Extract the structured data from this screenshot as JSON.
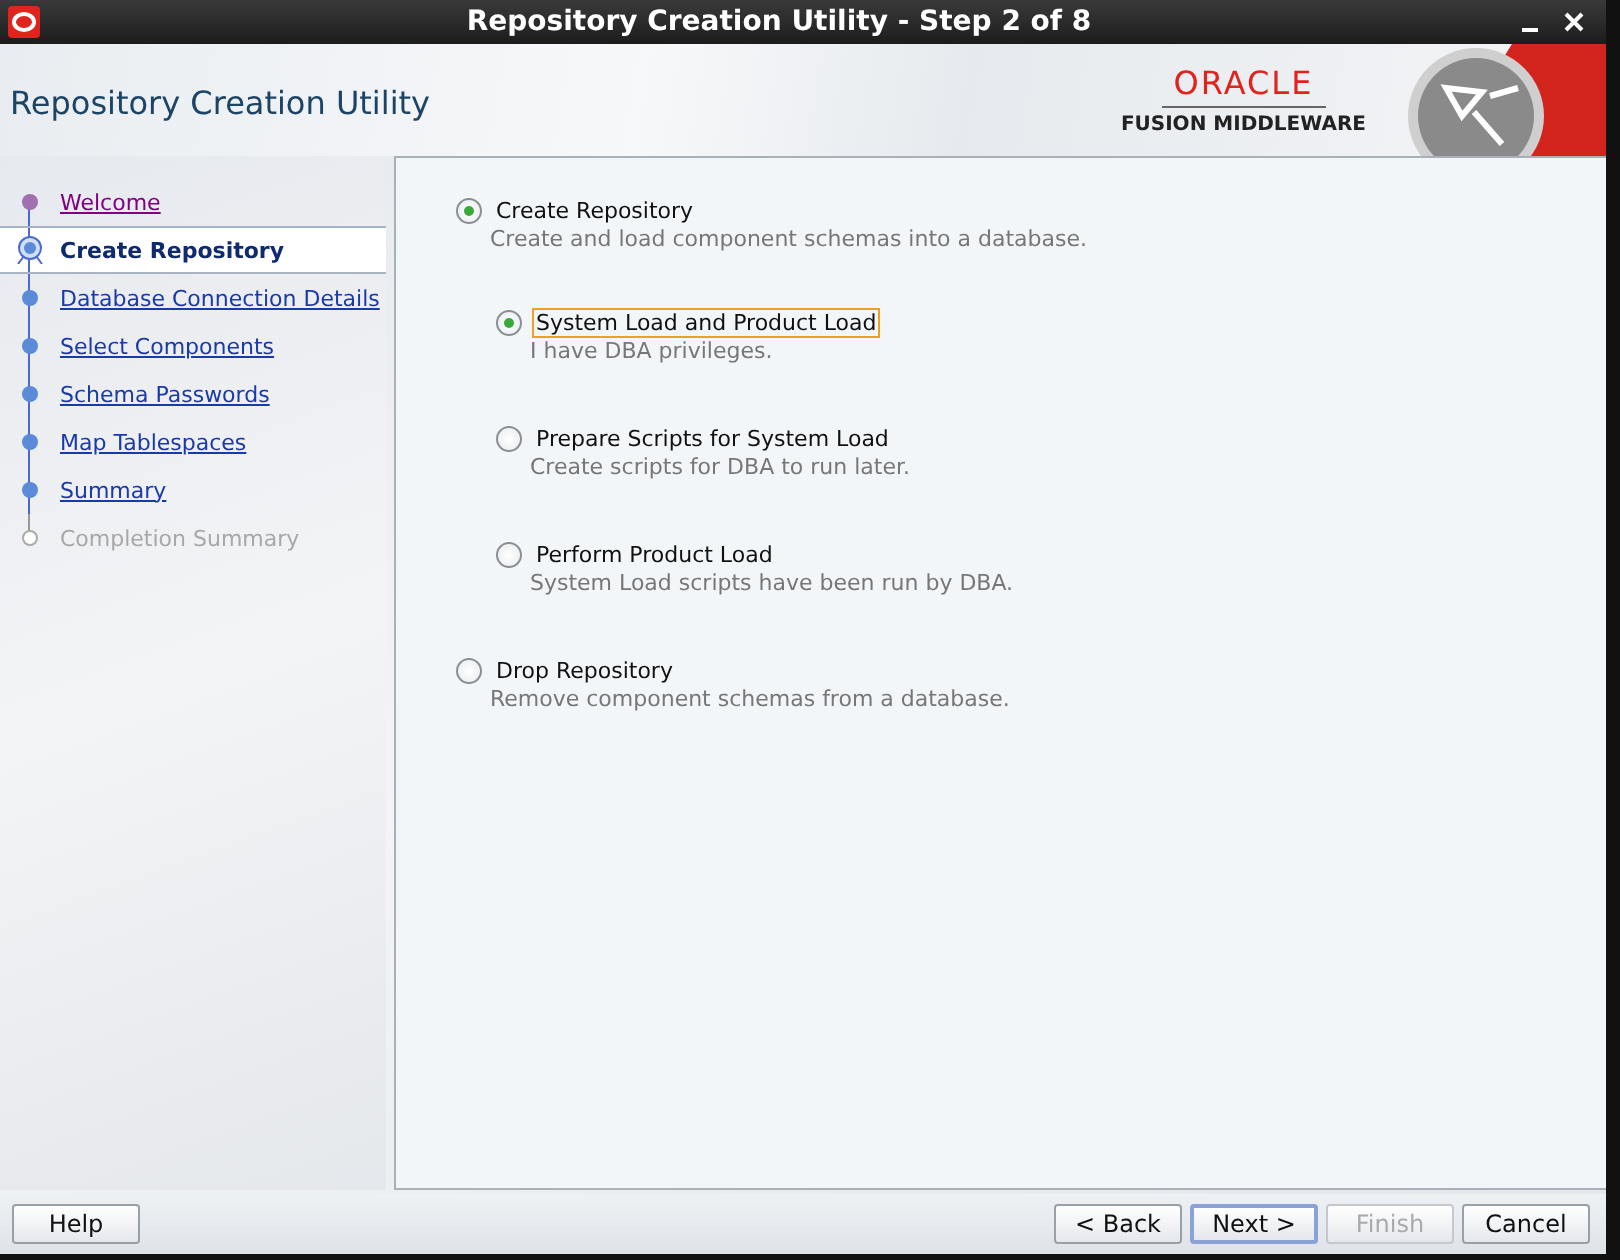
{
  "window": {
    "title": "Repository Creation Utility - Step 2 of 8"
  },
  "header": {
    "title": "Repository Creation Utility",
    "logo": "ORACLE",
    "product": "FUSION MIDDLEWARE"
  },
  "steps": [
    {
      "label": "Welcome",
      "selected": false,
      "visited": true,
      "disabled": false
    },
    {
      "label": "Create Repository",
      "selected": true,
      "visited": false,
      "disabled": false
    },
    {
      "label": "Database Connection Details",
      "selected": false,
      "visited": false,
      "disabled": false
    },
    {
      "label": "Select Components",
      "selected": false,
      "visited": false,
      "disabled": false
    },
    {
      "label": "Schema Passwords",
      "selected": false,
      "visited": false,
      "disabled": false
    },
    {
      "label": "Map Tablespaces",
      "selected": false,
      "visited": false,
      "disabled": false
    },
    {
      "label": "Summary",
      "selected": false,
      "visited": false,
      "disabled": false
    },
    {
      "label": "Completion Summary",
      "selected": false,
      "visited": false,
      "disabled": true
    }
  ],
  "options": [
    {
      "label": "Create Repository",
      "description": "Create and load component schemas into a database.",
      "selected": true,
      "focused": false,
      "children": [
        {
          "label": "System Load and Product Load",
          "description": "I have DBA privileges.",
          "selected": true,
          "focused": true
        },
        {
          "label": "Prepare Scripts for System Load",
          "description": "Create scripts for DBA to run later.",
          "selected": false,
          "focused": false
        },
        {
          "label": "Perform Product Load",
          "description": "System Load scripts have been run by DBA.",
          "selected": false,
          "focused": false
        }
      ]
    },
    {
      "label": "Drop Repository",
      "description": "Remove component schemas from a database.",
      "selected": false,
      "focused": false
    }
  ],
  "buttons": [
    {
      "label": "Help",
      "kind": "left",
      "disabled": false,
      "default": false
    },
    {
      "label": "< Back",
      "kind": "right",
      "disabled": false,
      "default": false
    },
    {
      "label": "Next >",
      "kind": "right",
      "disabled": false,
      "default": true
    },
    {
      "label": "Finish",
      "kind": "right",
      "disabled": true,
      "default": false
    },
    {
      "label": "Cancel",
      "kind": "right",
      "disabled": false,
      "default": false
    }
  ]
}
